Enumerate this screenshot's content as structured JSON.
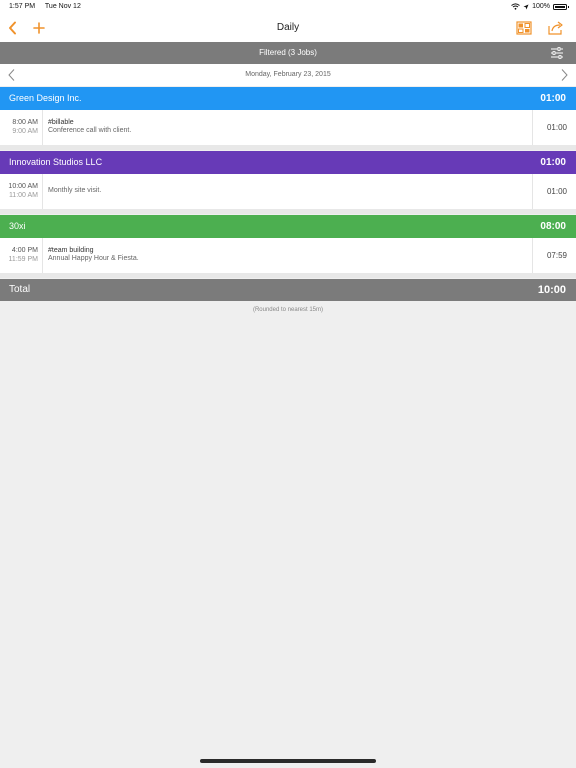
{
  "status_bar": {
    "time": "1:57 PM",
    "date": "Tue Nov 12",
    "battery": "100%",
    "icons": [
      "wifi-icon",
      "location-icon",
      "battery-icon"
    ]
  },
  "nav": {
    "title": "Daily",
    "left_icons": [
      "back-chevron-icon",
      "plus-icon"
    ],
    "right_icons": [
      "calendar-view-icon",
      "share-icon"
    ],
    "accent_color": "#f0922b"
  },
  "filter": {
    "label": "Filtered (3 Jobs)",
    "icon": "sliders-icon"
  },
  "date_nav": {
    "date": "Monday, February 23, 2015",
    "prev_icon": "chevron-left-icon",
    "next_icon": "chevron-right-icon"
  },
  "jobs": [
    {
      "name": "Green Design Inc.",
      "total": "01:00",
      "color": "#2196f3",
      "entries": [
        {
          "start": "8:00 AM",
          "end": "9:00 AM",
          "tag": "#billable",
          "note": "Conference call with client.",
          "duration": "01:00"
        }
      ]
    },
    {
      "name": "Innovation Studios LLC",
      "total": "01:00",
      "color": "#673ab7",
      "entries": [
        {
          "start": "10:00 AM",
          "end": "11:00 AM",
          "tag": "",
          "note": "Monthly site visit.",
          "duration": "01:00"
        }
      ]
    },
    {
      "name": "30xi",
      "total": "08:00",
      "color": "#4caf50",
      "entries": [
        {
          "start": "4:00 PM",
          "end": "11:59 PM",
          "tag": "#team building",
          "note": "Annual Happy Hour & Fiesta.",
          "duration": "07:59"
        }
      ]
    }
  ],
  "total": {
    "label": "Total",
    "value": "10:00",
    "note": "(Rounded to nearest 15m)"
  }
}
